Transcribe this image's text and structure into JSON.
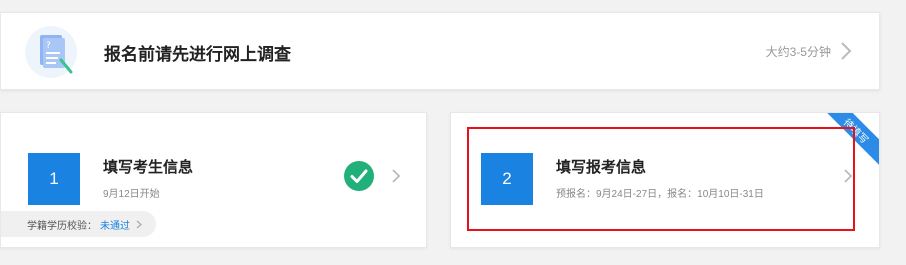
{
  "survey": {
    "title": "报名前请先进行网上调查",
    "duration": "大约3-5分钟",
    "icon": "survey-document-icon"
  },
  "steps": [
    {
      "number": "1",
      "title": "填写考生信息",
      "subtitle": "9月12日开始",
      "completed": true,
      "verify_label": "学籍学历校验：",
      "verify_status": "未通过"
    },
    {
      "number": "2",
      "title": "填写报考信息",
      "subtitle": "预报名：9月24日-27日，报名：10月10日-31日",
      "ribbon": "待填写"
    }
  ],
  "colors": {
    "accent": "#1a82e0",
    "success": "#21b07a",
    "highlight": "#e8101a"
  }
}
